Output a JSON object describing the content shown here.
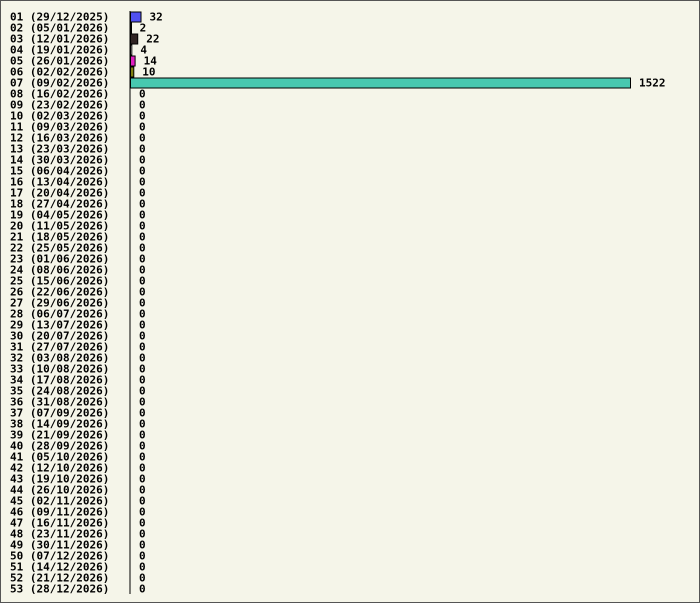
{
  "chart_data": {
    "type": "bar",
    "orientation": "horizontal",
    "title": "",
    "xlabel": "",
    "ylabel": "",
    "grid": false,
    "xlim": [
      0,
      1522
    ],
    "categories": [
      "01 (29/12/2025)",
      "02 (05/01/2026)",
      "03 (12/01/2026)",
      "04 (19/01/2026)",
      "05 (26/01/2026)",
      "06 (02/02/2026)",
      "07 (09/02/2026)",
      "08 (16/02/2026)",
      "09 (23/02/2026)",
      "10 (02/03/2026)",
      "11 (09/03/2026)",
      "12 (16/03/2026)",
      "13 (23/03/2026)",
      "14 (30/03/2026)",
      "15 (06/04/2026)",
      "16 (13/04/2026)",
      "17 (20/04/2026)",
      "18 (27/04/2026)",
      "19 (04/05/2026)",
      "20 (11/05/2026)",
      "21 (18/05/2026)",
      "22 (25/05/2026)",
      "23 (01/06/2026)",
      "24 (08/06/2026)",
      "25 (15/06/2026)",
      "26 (22/06/2026)",
      "27 (29/06/2026)",
      "28 (06/07/2026)",
      "29 (13/07/2026)",
      "30 (20/07/2026)",
      "31 (27/07/2026)",
      "32 (03/08/2026)",
      "33 (10/08/2026)",
      "34 (17/08/2026)",
      "35 (24/08/2026)",
      "36 (31/08/2026)",
      "37 (07/09/2026)",
      "38 (14/09/2026)",
      "39 (21/09/2026)",
      "40 (28/09/2026)",
      "41 (05/10/2026)",
      "42 (12/10/2026)",
      "43 (19/10/2026)",
      "44 (26/10/2026)",
      "45 (02/11/2026)",
      "46 (09/11/2026)",
      "47 (16/11/2026)",
      "48 (23/11/2026)",
      "49 (30/11/2026)",
      "50 (07/12/2026)",
      "51 (14/12/2026)",
      "52 (21/12/2026)",
      "53 (28/12/2026)"
    ],
    "values": [
      32,
      2,
      22,
      4,
      14,
      10,
      1522,
      0,
      0,
      0,
      0,
      0,
      0,
      0,
      0,
      0,
      0,
      0,
      0,
      0,
      0,
      0,
      0,
      0,
      0,
      0,
      0,
      0,
      0,
      0,
      0,
      0,
      0,
      0,
      0,
      0,
      0,
      0,
      0,
      0,
      0,
      0,
      0,
      0,
      0,
      0,
      0,
      0,
      0,
      0,
      0,
      0,
      0
    ],
    "colors": [
      "#5050f0",
      "#ffffff",
      "#302424",
      "#ffffff",
      "#e020c0",
      "#808010",
      "#48c8b0"
    ]
  }
}
